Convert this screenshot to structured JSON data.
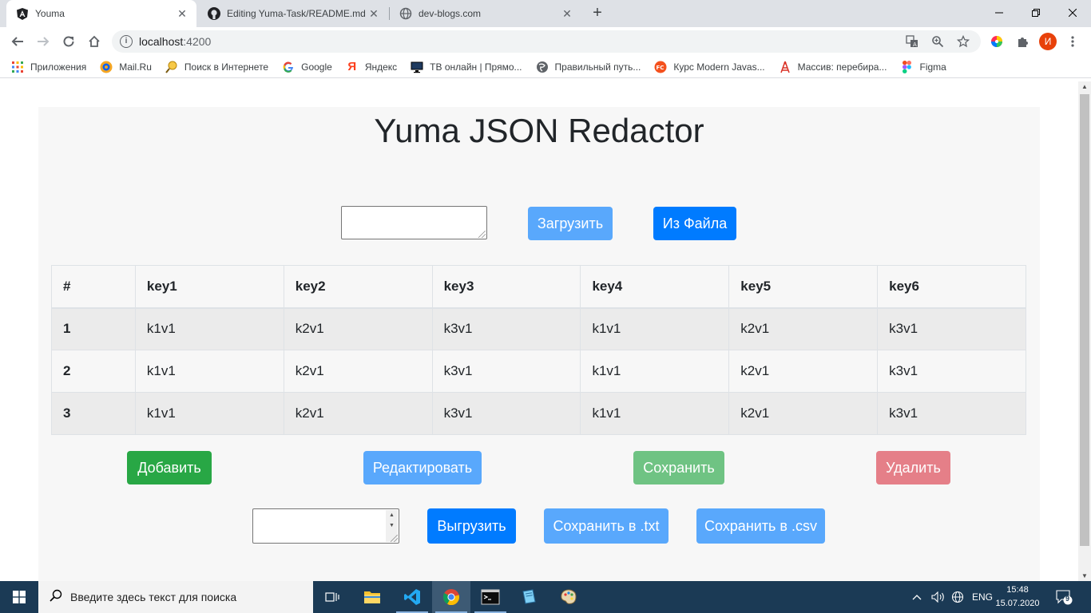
{
  "browser": {
    "tabs": [
      {
        "title": "Youma",
        "icon": "angular-icon",
        "active": true
      },
      {
        "title": "Editing Yuma-Task/README.md a",
        "icon": "github-icon",
        "active": false
      },
      {
        "title": "dev-blogs.com",
        "icon": "globe-icon",
        "active": false
      }
    ],
    "url_host": "localhost",
    "url_port": ":4200",
    "profile_letter": "И",
    "bookmarks": [
      {
        "label": "Приложения",
        "icon": "apps-grid-icon"
      },
      {
        "label": "Mail.Ru",
        "icon": "mailru-icon"
      },
      {
        "label": "Поиск в Интернете",
        "icon": "search-globe-icon"
      },
      {
        "label": "Google",
        "icon": "google-icon"
      },
      {
        "label": "Яндекс",
        "icon": "yandex-icon"
      },
      {
        "label": "ТВ онлайн | Прямо...",
        "icon": "tv-icon"
      },
      {
        "label": "Правильный путь...",
        "icon": "globe-icon"
      },
      {
        "label": "Курс Modern Javas...",
        "icon": "fc-icon"
      },
      {
        "label": "Массив: перебира...",
        "icon": "tower-icon"
      },
      {
        "label": "Figma",
        "icon": "figma-icon"
      }
    ]
  },
  "page": {
    "title": "Yuma JSON Redactor",
    "load_button": "Загрузить",
    "from_file_button": "Из Файла",
    "table": {
      "headers": [
        "#",
        "key1",
        "key2",
        "key3",
        "key4",
        "key5",
        "key6"
      ],
      "rows": [
        {
          "num": "1",
          "cells": [
            "k1v1",
            "k2v1",
            "k3v1",
            "k1v1",
            "k2v1",
            "k3v1"
          ]
        },
        {
          "num": "2",
          "cells": [
            "k1v1",
            "k2v1",
            "k3v1",
            "k1v1",
            "k2v1",
            "k3v1"
          ]
        },
        {
          "num": "3",
          "cells": [
            "k1v1",
            "k2v1",
            "k3v1",
            "k1v1",
            "k2v1",
            "k3v1"
          ]
        }
      ]
    },
    "add_button": "Добавить",
    "edit_button": "Редактировать",
    "save_button": "Сохранить",
    "delete_button": "Удалить",
    "export_button": "Выгрузить",
    "save_txt_button": "Сохранить в .txt",
    "save_csv_button": "Сохранить в .csv"
  },
  "taskbar": {
    "search_placeholder": "Введите здесь текст для поиска",
    "lang": "ENG",
    "time": "15:48",
    "date": "15.07.2020",
    "notifications": "9"
  },
  "colors": {
    "primary": "#007bff",
    "primary_disabled": "#59a8fc",
    "success": "#28a745",
    "success_disabled": "#6fc383",
    "danger_disabled": "#e57f88",
    "taskbar": "#1b3a55"
  }
}
